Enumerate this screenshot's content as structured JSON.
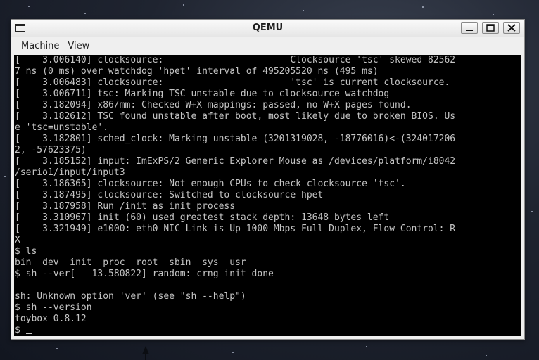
{
  "window": {
    "title": "QEMU"
  },
  "menu": {
    "items": [
      "Machine",
      "View"
    ]
  },
  "terminal": {
    "lines": [
      "[    3.006140] clocksource:                       Clocksource 'tsc' skewed 82562",
      "7 ns (0 ms) over watchdog 'hpet' interval of 495205520 ns (495 ms)",
      "[    3.006483] clocksource:                       'tsc' is current clocksource.",
      "[    3.006711] tsc: Marking TSC unstable due to clocksource watchdog",
      "[    3.182094] x86/mm: Checked W+X mappings: passed, no W+X pages found.",
      "[    3.182612] TSC found unstable after boot, most likely due to broken BIOS. Us",
      "e 'tsc=unstable'.",
      "[    3.182801] sched_clock: Marking unstable (3201319028, -18776016)<-(324017206",
      "2, -57623375)",
      "[    3.185152] input: ImExPS/2 Generic Explorer Mouse as /devices/platform/i8042",
      "/serio1/input/input3",
      "[    3.186365] clocksource: Not enough CPUs to check clocksource 'tsc'.",
      "[    3.187495] clocksource: Switched to clocksource hpet",
      "[    3.187958] Run /init as init process",
      "[    3.310967] init (60) used greatest stack depth: 13648 bytes left",
      "[    3.321949] e1000: eth0 NIC Link is Up 1000 Mbps Full Duplex, Flow Control: R",
      "X",
      "$ ls",
      "bin  dev  init  proc  root  sbin  sys  usr",
      "$ sh --ver[   13.580822] random: crng init done",
      "",
      "sh: Unknown option 'ver' (see \"sh --help\")",
      "$ sh --version",
      "toybox 0.8.12",
      "$ "
    ]
  },
  "colors": {
    "terminal_bg": "#000000",
    "terminal_fg": "#c4c4c4",
    "chrome_bg": "#efefef"
  },
  "icons": {
    "window": "window-icon",
    "minimize": "minimize-icon",
    "maximize": "maximize-icon",
    "close": "close-icon"
  }
}
